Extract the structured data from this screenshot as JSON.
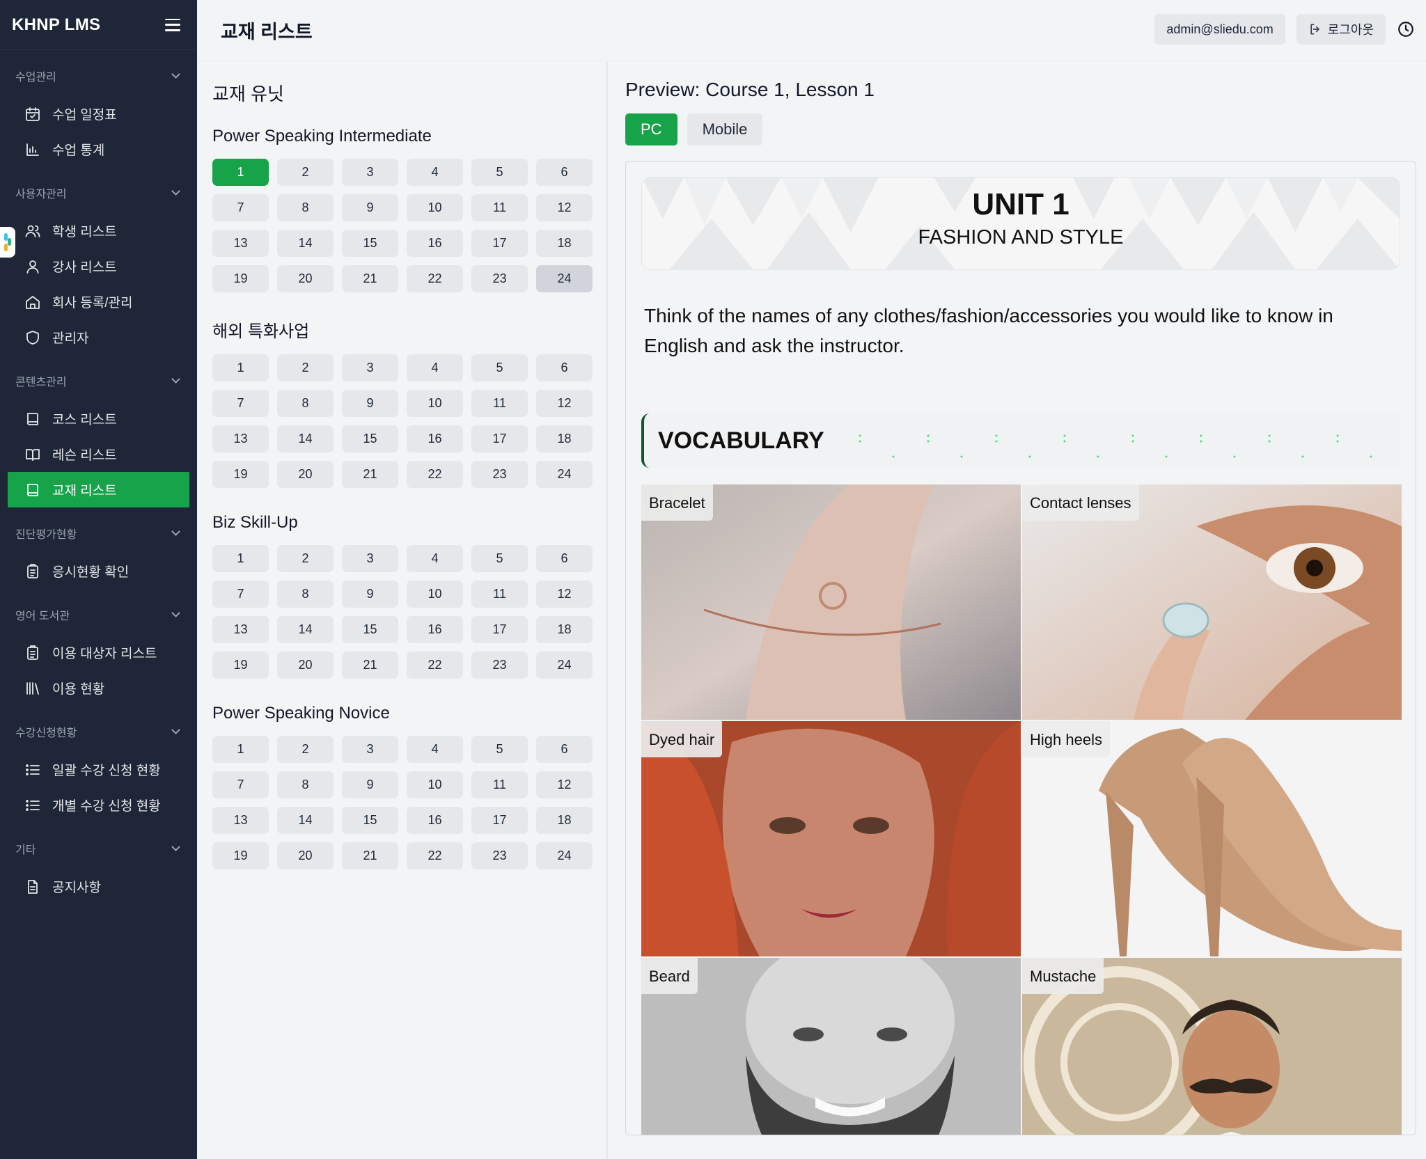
{
  "brand": "KHNP LMS",
  "page_title": "교재 리스트",
  "user_email": "admin@sliedu.com",
  "logout_label": "로그아웃",
  "sidebar": [
    {
      "title": "수업관리",
      "items": [
        {
          "label": "수업 일정표",
          "icon": "calendar-icon"
        },
        {
          "label": "수업 통계",
          "icon": "bar-chart-icon"
        }
      ]
    },
    {
      "title": "사용자관리",
      "items": [
        {
          "label": "학생 리스트",
          "icon": "users-icon"
        },
        {
          "label": "강사 리스트",
          "icon": "user-icon"
        },
        {
          "label": "회사 등록/관리",
          "icon": "home-icon"
        },
        {
          "label": "관리자",
          "icon": "shield-icon"
        }
      ]
    },
    {
      "title": "콘텐츠관리",
      "items": [
        {
          "label": "코스 리스트",
          "icon": "book-icon"
        },
        {
          "label": "레슨 리스트",
          "icon": "open-book-icon"
        },
        {
          "label": "교재 리스트",
          "icon": "book-icon",
          "active": true
        }
      ]
    },
    {
      "title": "진단평가현황",
      "items": [
        {
          "label": "응시현황 확인",
          "icon": "clipboard-icon"
        }
      ]
    },
    {
      "title": "영어 도서관",
      "items": [
        {
          "label": "이용 대상자 리스트",
          "icon": "clipboard-icon"
        },
        {
          "label": "이용 현황",
          "icon": "library-icon"
        }
      ]
    },
    {
      "title": "수강신청현황",
      "items": [
        {
          "label": "일괄 수강 신청 현황",
          "icon": "list-icon"
        },
        {
          "label": "개별 수강 신청 현황",
          "icon": "list-icon"
        }
      ]
    },
    {
      "title": "기타",
      "items": [
        {
          "label": "공지사항",
          "icon": "document-icon"
        }
      ]
    }
  ],
  "units_panel": {
    "title": "교재 유닛",
    "courses": [
      {
        "name": "Power Speaking Intermediate",
        "units": [
          "1",
          "2",
          "3",
          "4",
          "5",
          "6",
          "7",
          "8",
          "9",
          "10",
          "11",
          "12",
          "13",
          "14",
          "15",
          "16",
          "17",
          "18",
          "19",
          "20",
          "21",
          "22",
          "23",
          "24"
        ],
        "selected": "1",
        "hovered": "24"
      },
      {
        "name": "해외 특화사업",
        "units": [
          "1",
          "2",
          "3",
          "4",
          "5",
          "6",
          "7",
          "8",
          "9",
          "10",
          "11",
          "12",
          "13",
          "14",
          "15",
          "16",
          "17",
          "18",
          "19",
          "20",
          "21",
          "22",
          "23",
          "24"
        ]
      },
      {
        "name": "Biz Skill-Up",
        "units": [
          "1",
          "2",
          "3",
          "4",
          "5",
          "6",
          "7",
          "8",
          "9",
          "10",
          "11",
          "12",
          "13",
          "14",
          "15",
          "16",
          "17",
          "18",
          "19",
          "20",
          "21",
          "22",
          "23",
          "24"
        ]
      },
      {
        "name": "Power Speaking Novice",
        "units": [
          "1",
          "2",
          "3",
          "4",
          "5",
          "6",
          "7",
          "8",
          "9",
          "10",
          "11",
          "12",
          "13",
          "14",
          "15",
          "16",
          "17",
          "18",
          "19",
          "20",
          "21",
          "22",
          "23",
          "24"
        ]
      }
    ]
  },
  "preview": {
    "title": "Preview: Course 1, Lesson 1",
    "pc_label": "PC",
    "mobile_label": "Mobile",
    "unit_title": "UNIT 1",
    "unit_subtitle": "FASHION AND STYLE",
    "instruction": "Think of the names of any clothes/fashion/accessories you would like to know in English and ask the instructor.",
    "vocab_heading": "VOCABULARY",
    "photos": [
      {
        "label": "Bracelet",
        "icon": "bracelet-photo"
      },
      {
        "label": "Contact lenses",
        "icon": "contact-lens-photo"
      },
      {
        "label": "Dyed hair",
        "icon": "dyed-hair-photo"
      },
      {
        "label": "High heels",
        "icon": "high-heels-photo"
      },
      {
        "label": "Beard",
        "icon": "beard-photo"
      },
      {
        "label": "Mustache",
        "icon": "mustache-photo"
      }
    ]
  },
  "colors": {
    "accent": "#16a34a",
    "sidebar_bg": "#1e2637",
    "cell_bg": "#e5e7eb"
  }
}
